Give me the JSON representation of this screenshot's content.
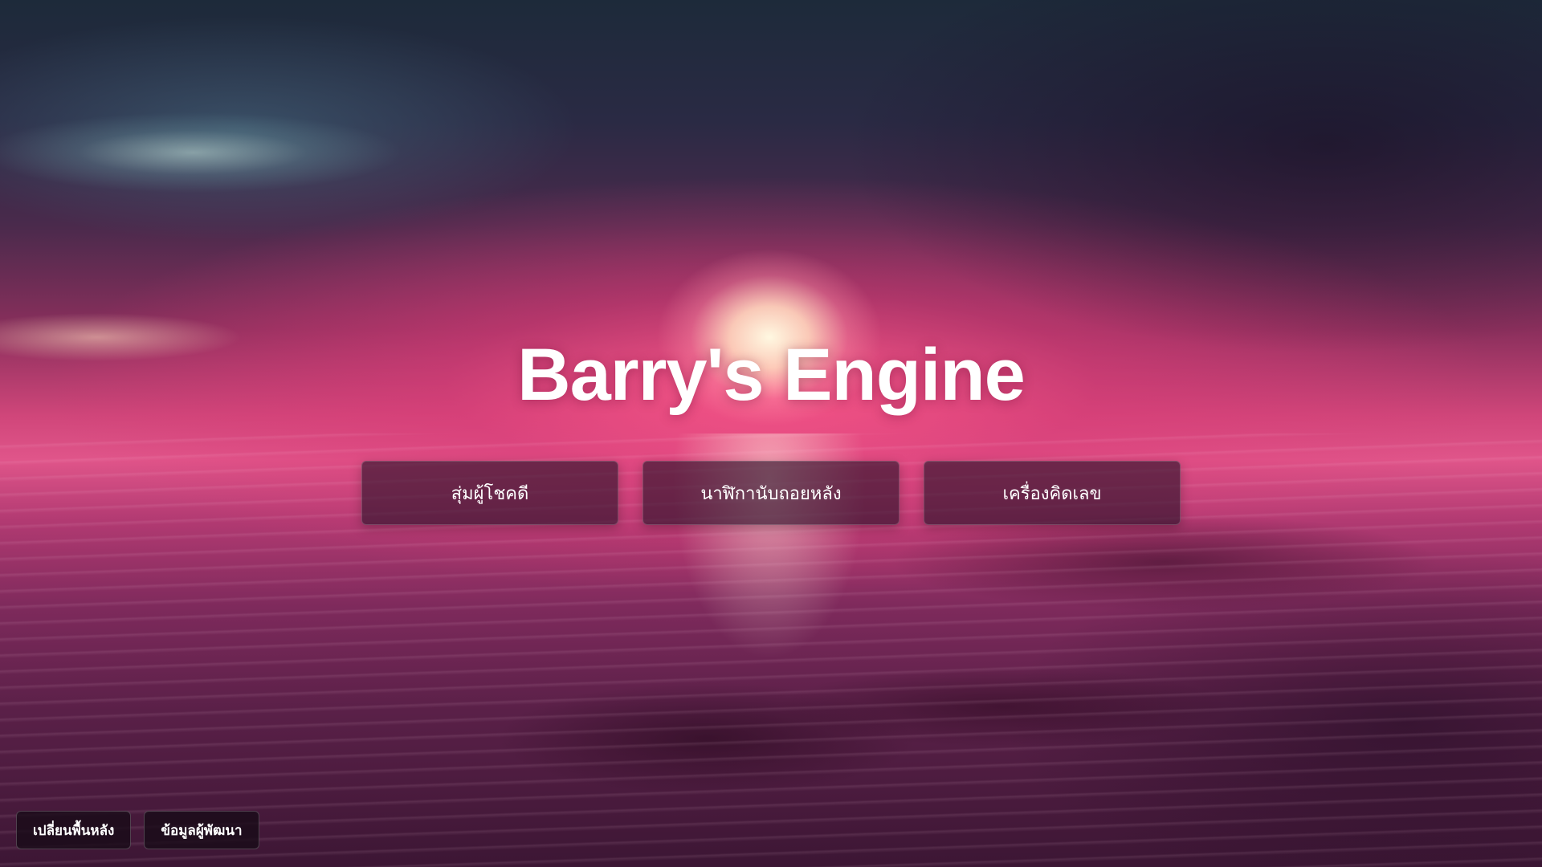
{
  "app": {
    "title": "Barry's Engine"
  },
  "menu": {
    "items": [
      {
        "label": "สุ่มผู้โชคดี"
      },
      {
        "label": "นาฬิกานับถอยหลัง"
      },
      {
        "label": "เครื่องคิดเลข"
      }
    ]
  },
  "footer": {
    "change_background_label": "เปลี่ยนพื้นหลัง",
    "developer_info_label": "ข้อมูลผู้พัฒนา"
  },
  "colors": {
    "button_bg": "#28122866",
    "title_text": "#ffffff",
    "sky_top": "#1d2a3a",
    "horizon_glow": "#e0558a"
  }
}
